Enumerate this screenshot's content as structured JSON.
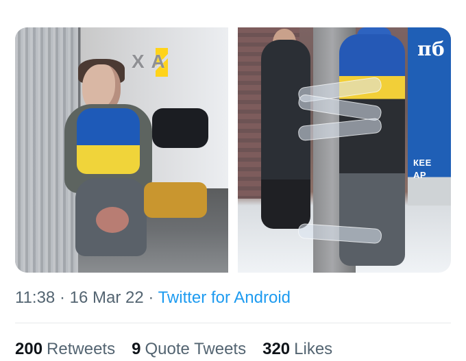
{
  "tweet": {
    "media": [
      {
        "description_label": "Left photo",
        "watermark_text": "Х А",
        "watermark_icon": "bolt-icon"
      },
      {
        "description_label": "Right photo",
        "poster_top_text": "пб",
        "poster_bottom_text": "КЕЕ\nАР"
      }
    ],
    "meta": {
      "time": "11:38",
      "date": "16 Mar 22",
      "source": "Twitter for Android"
    },
    "metrics": [
      {
        "count": "200",
        "label": "Retweets"
      },
      {
        "count": "9",
        "label": "Quote Tweets"
      },
      {
        "count": "320",
        "label": "Likes"
      }
    ]
  }
}
